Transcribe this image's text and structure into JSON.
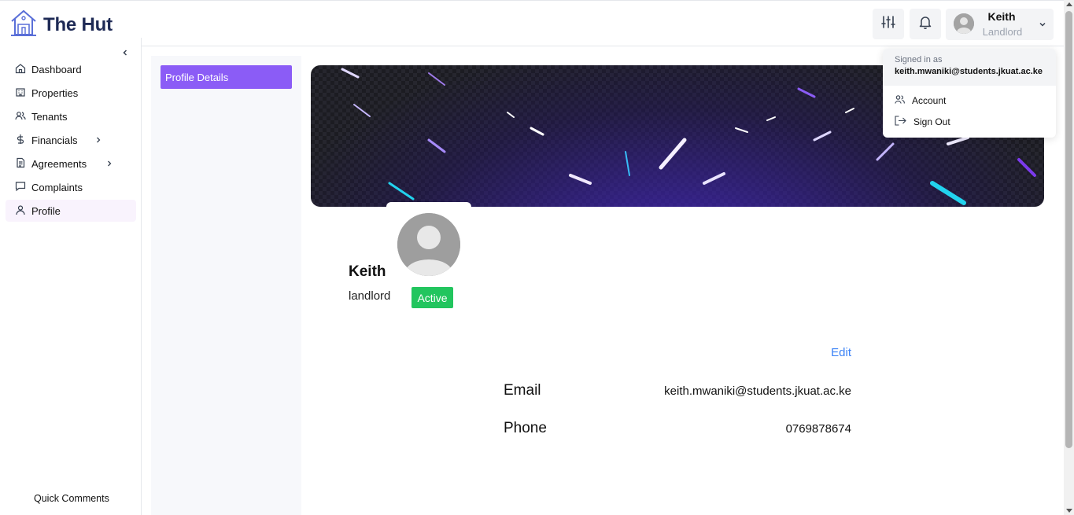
{
  "app": {
    "title": "The Hut"
  },
  "header": {
    "user": {
      "name": "Keith",
      "role": "Landlord"
    }
  },
  "sidebar": {
    "items": [
      {
        "label": "Dashboard",
        "icon": "home-icon"
      },
      {
        "label": "Properties",
        "icon": "building-icon"
      },
      {
        "label": "Tenants",
        "icon": "users-icon"
      },
      {
        "label": "Financials",
        "icon": "dollar-icon",
        "has_submenu": true
      },
      {
        "label": "Agreements",
        "icon": "document-icon",
        "has_submenu": true
      },
      {
        "label": "Complaints",
        "icon": "message-icon"
      },
      {
        "label": "Profile",
        "icon": "user-icon",
        "active": true
      }
    ],
    "quick_comments": "Quick Comments"
  },
  "profile_tabs": {
    "active": "Profile Details"
  },
  "profile": {
    "name": "Keith",
    "role": "landlord",
    "status": "Active",
    "edit_label": "Edit",
    "fields": [
      {
        "label": "Email",
        "value": "keith.mwaniki@students.jkuat.ac.ke"
      },
      {
        "label": "Phone",
        "value": "0769878674"
      }
    ]
  },
  "dropdown": {
    "signed_in_as": "Signed in as",
    "email": "keith.mwaniki@students.jkuat.ac.ke",
    "items": [
      {
        "label": "Account",
        "icon": "account-icon"
      },
      {
        "label": "Sign Out",
        "icon": "sign-out-icon"
      }
    ]
  },
  "colors": {
    "accent": "#8b5cf6",
    "brand": "#1e2a55",
    "status_active": "#22c55e",
    "link": "#3b82f6"
  }
}
